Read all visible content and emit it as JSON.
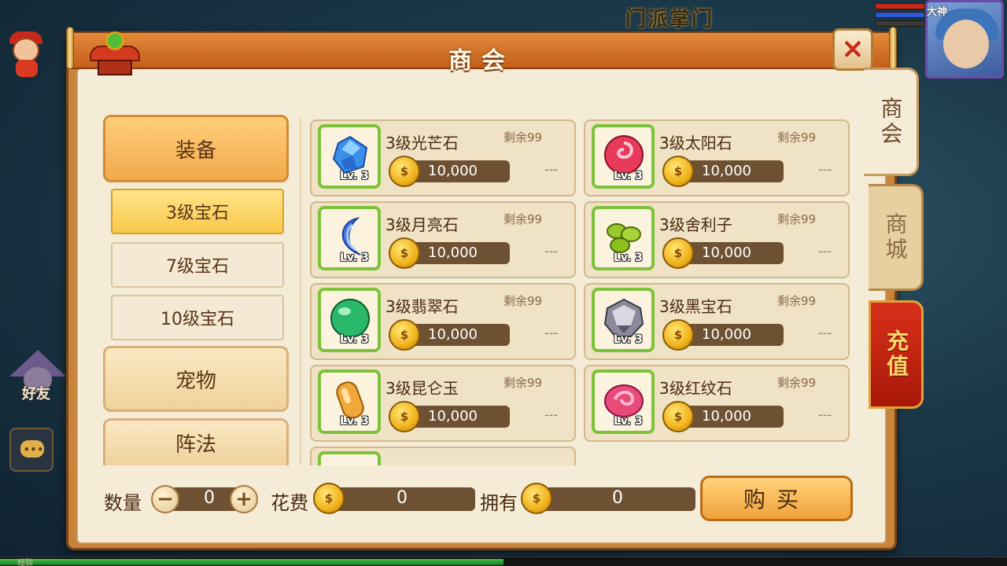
{
  "background": {
    "top_text": "门派掌门",
    "avatar_name": "大神",
    "friend_label": "好友",
    "xp_label": "经验"
  },
  "dialog": {
    "title": "商会",
    "close_label": "✕"
  },
  "side_tabs": [
    {
      "label": "商会",
      "active": true
    },
    {
      "label": "商城",
      "active": false
    },
    {
      "label": "充值",
      "active": false
    }
  ],
  "categories": {
    "equipment": "装备",
    "pet": "宠物",
    "formation": "阵法"
  },
  "subcategories": [
    "3级宝石",
    "7级宝石",
    "10级宝石"
  ],
  "items": [
    {
      "name": "3级光芒石",
      "stock": "剩余99",
      "price": "10,000",
      "level": "Lv. 3",
      "dash": "---"
    },
    {
      "name": "3级太阳石",
      "stock": "剩余99",
      "price": "10,000",
      "level": "Lv. 3",
      "dash": "---"
    },
    {
      "name": "3级月亮石",
      "stock": "剩余99",
      "price": "10,000",
      "level": "Lv. 3",
      "dash": "---"
    },
    {
      "name": "3级舍利子",
      "stock": "剩余99",
      "price": "10,000",
      "level": "Lv. 3",
      "dash": "---"
    },
    {
      "name": "3级翡翠石",
      "stock": "剩余99",
      "price": "10,000",
      "level": "Lv. 3",
      "dash": "---"
    },
    {
      "name": "3级黑宝石",
      "stock": "剩余99",
      "price": "10,000",
      "level": "Lv. 3",
      "dash": "---"
    },
    {
      "name": "3级昆仑玉",
      "stock": "剩余99",
      "price": "10,000",
      "level": "Lv. 3",
      "dash": "---"
    },
    {
      "name": "3级红纹石",
      "stock": "剩余99",
      "price": "10,000",
      "level": "Lv. 3",
      "dash": "---"
    },
    {
      "name": "",
      "stock": "",
      "price": "",
      "level": "",
      "dash": ""
    }
  ],
  "purchase": {
    "quantity_label": "数量",
    "quantity": "0",
    "minus": "−",
    "plus": "+",
    "cost_label": "花费",
    "cost": "0",
    "owned_label": "拥有",
    "owned": "0",
    "buy_label": "购买"
  },
  "colors": {
    "title_bar": "#d9742a",
    "paper": "#f5ecd8",
    "icon_border": "#7cc23a",
    "price_bar": "#6e5132",
    "recharge_tab": "#c8281a"
  }
}
